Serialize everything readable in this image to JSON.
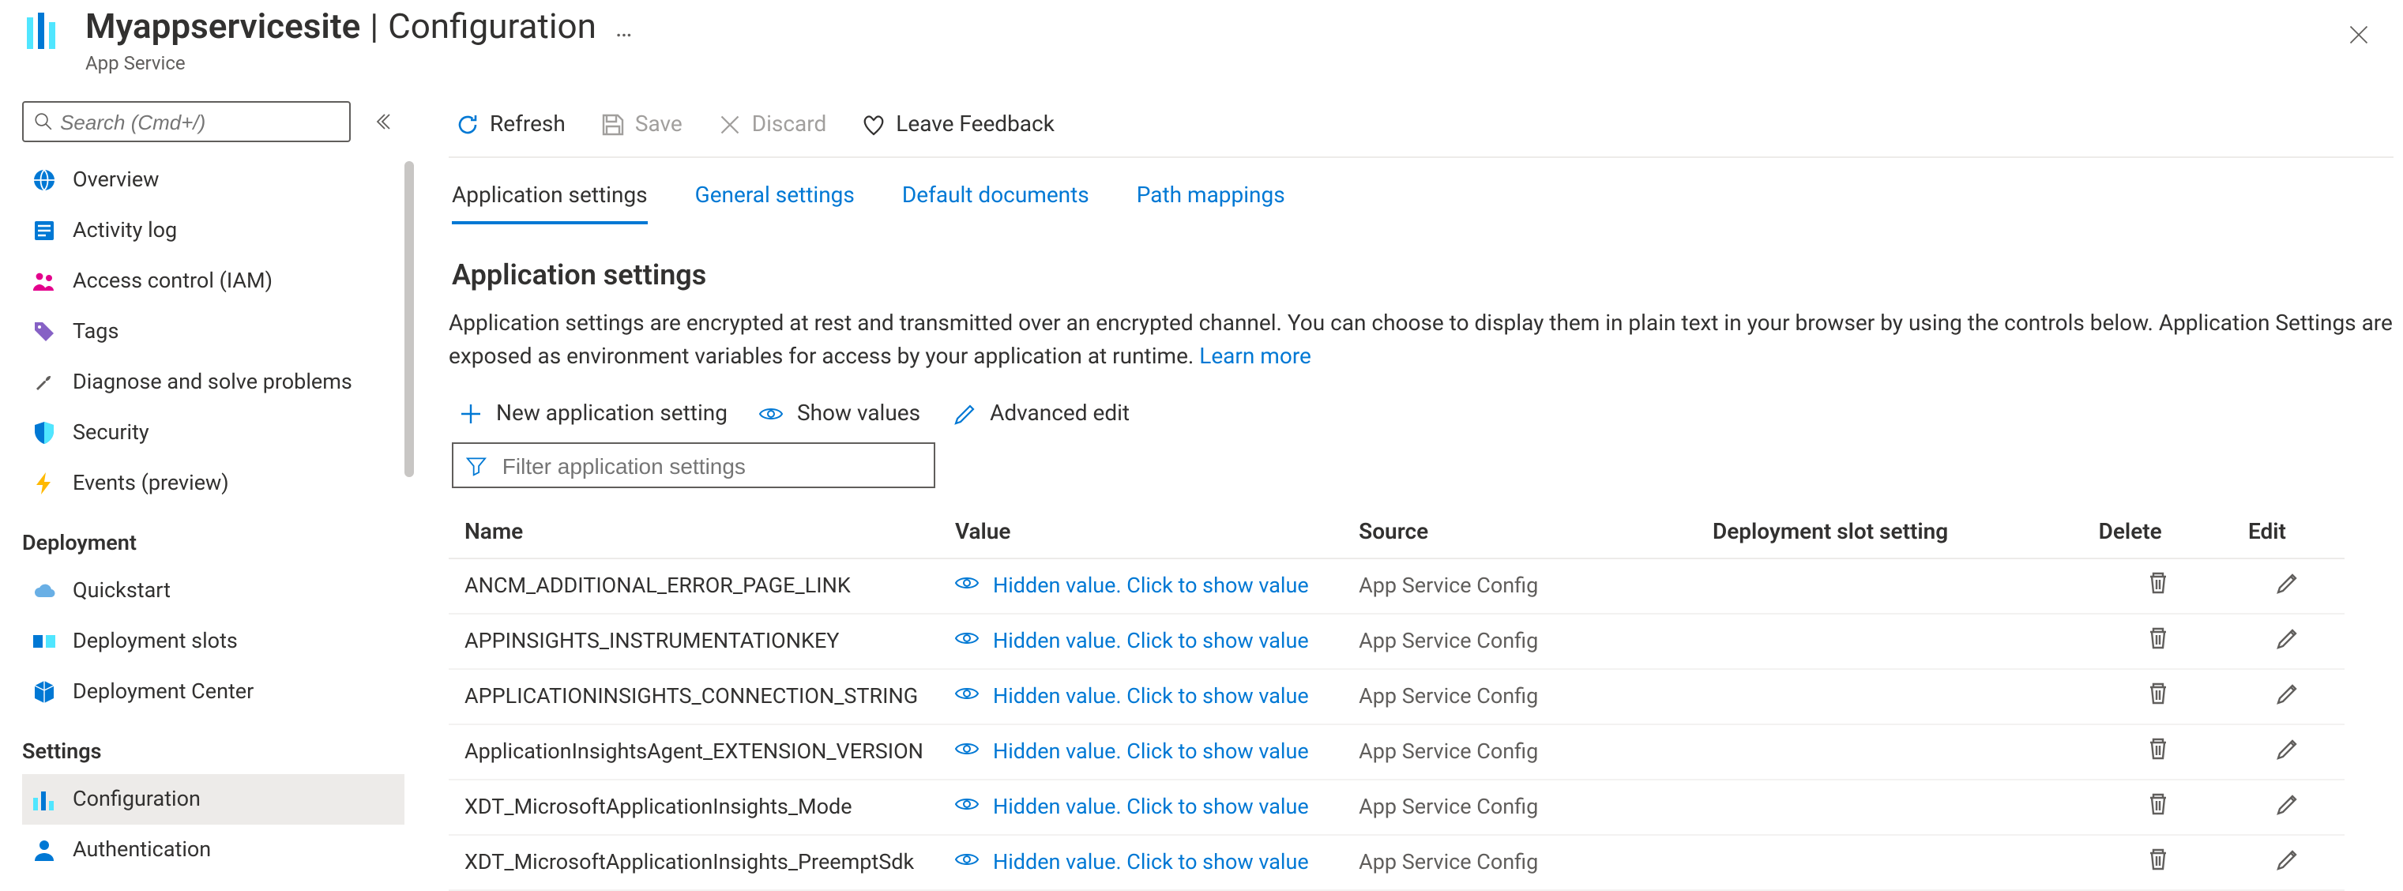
{
  "header": {
    "title_main": "Myappservicesite",
    "title_page": "Configuration",
    "subtitle": "App Service"
  },
  "sidebar": {
    "search_placeholder": "Search (Cmd+/)",
    "groups": [
      {
        "label": "",
        "items": [
          {
            "label": "Overview",
            "icon": "globe",
            "selected": false
          },
          {
            "label": "Activity log",
            "icon": "log",
            "selected": false
          },
          {
            "label": "Access control (IAM)",
            "icon": "people",
            "selected": false
          },
          {
            "label": "Tags",
            "icon": "tag",
            "selected": false
          },
          {
            "label": "Diagnose and solve problems",
            "icon": "wrench",
            "selected": false
          },
          {
            "label": "Security",
            "icon": "shield",
            "selected": false
          },
          {
            "label": "Events (preview)",
            "icon": "bolt",
            "selected": false
          }
        ]
      },
      {
        "label": "Deployment",
        "items": [
          {
            "label": "Quickstart",
            "icon": "cloud",
            "selected": false
          },
          {
            "label": "Deployment slots",
            "icon": "slots",
            "selected": false
          },
          {
            "label": "Deployment Center",
            "icon": "cube",
            "selected": false
          }
        ]
      },
      {
        "label": "Settings",
        "items": [
          {
            "label": "Configuration",
            "icon": "bars",
            "selected": true
          },
          {
            "label": "Authentication",
            "icon": "person",
            "selected": false
          }
        ]
      }
    ]
  },
  "command_bar": {
    "refresh": "Refresh",
    "save": "Save",
    "discard": "Discard",
    "feedback": "Leave Feedback"
  },
  "tabs": [
    {
      "label": "Application settings",
      "active": true
    },
    {
      "label": "General settings",
      "active": false
    },
    {
      "label": "Default documents",
      "active": false
    },
    {
      "label": "Path mappings",
      "active": false
    }
  ],
  "section": {
    "title": "Application settings",
    "body_1": "Application settings are encrypted at rest and transmitted over an encrypted channel. You can choose to display them in plain text in your browser by using the controls below. Application Settings are exposed as environment variables for access by your application at runtime. ",
    "learn_more": "Learn more"
  },
  "actions": {
    "new_setting": "New application setting",
    "show_values": "Show values",
    "advanced_edit": "Advanced edit",
    "filter_placeholder": "Filter application settings"
  },
  "table": {
    "columns": {
      "name": "Name",
      "value": "Value",
      "source": "Source",
      "slot": "Deployment slot setting",
      "delete": "Delete",
      "edit": "Edit"
    },
    "hidden_value_text": "Hidden value. Click to show value",
    "rows": [
      {
        "name": "ANCM_ADDITIONAL_ERROR_PAGE_LINK",
        "source": "App Service Config"
      },
      {
        "name": "APPINSIGHTS_INSTRUMENTATIONKEY",
        "source": "App Service Config"
      },
      {
        "name": "APPLICATIONINSIGHTS_CONNECTION_STRING",
        "source": "App Service Config"
      },
      {
        "name": "ApplicationInsightsAgent_EXTENSION_VERSION",
        "source": "App Service Config"
      },
      {
        "name": "XDT_MicrosoftApplicationInsights_Mode",
        "source": "App Service Config"
      },
      {
        "name": "XDT_MicrosoftApplicationInsights_PreemptSdk",
        "source": "App Service Config"
      }
    ]
  }
}
